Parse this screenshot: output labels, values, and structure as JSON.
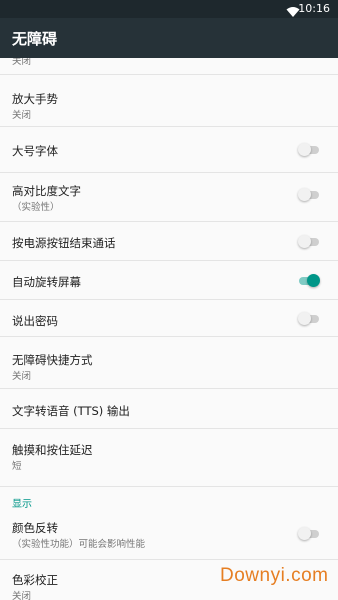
{
  "status_bar": {
    "time": "10:16",
    "wifi_icon": "wifi-icon"
  },
  "app_bar": {
    "title": "无障碍"
  },
  "accent_color": "#009688",
  "settings": [
    {
      "label": "",
      "subtitle": "关闭"
    },
    {
      "label": "放大手势",
      "subtitle": "关闭"
    },
    {
      "label": "大号字体",
      "toggle": false
    },
    {
      "label": "高对比度文字",
      "subtitle": "（实验性）",
      "toggle": false
    },
    {
      "label": "按电源按钮结束通话",
      "toggle": false
    },
    {
      "label": "自动旋转屏幕",
      "toggle": true
    },
    {
      "label": "说出密码",
      "toggle": false
    },
    {
      "label": "无障碍快捷方式",
      "subtitle": "关闭"
    },
    {
      "label": "文字转语音 (TTS) 输出"
    },
    {
      "label": "触摸和按住延迟",
      "subtitle": "短"
    },
    {
      "label": "颜色反转",
      "subtitle": "（实验性功能）可能会影响性能",
      "toggle": false
    },
    {
      "label": "色彩校正",
      "subtitle": "关闭"
    }
  ],
  "section_display": "显示",
  "watermark": "Downyi.com"
}
